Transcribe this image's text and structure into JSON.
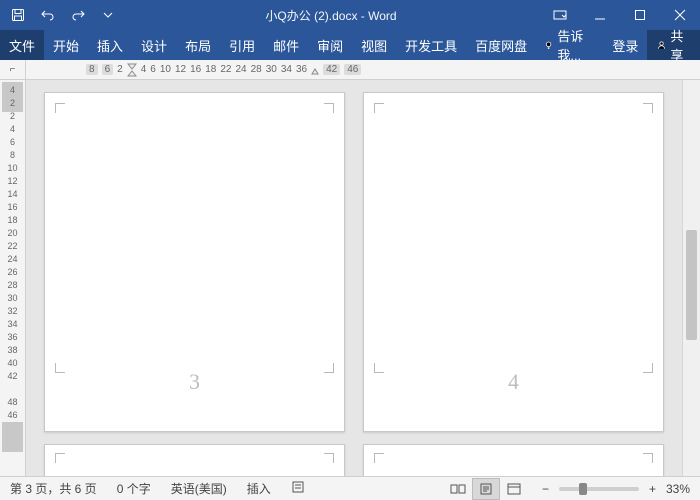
{
  "title": "小Q办公 (2).docx - Word",
  "qat": {
    "save": "save-icon",
    "undo": "undo-icon",
    "redo": "redo-icon"
  },
  "win": {
    "ribbon_opts": "ribbon-options",
    "min": "minimize",
    "max": "maximize",
    "close": "close"
  },
  "tabs": {
    "file": "文件",
    "home": "开始",
    "insert": "插入",
    "design": "设计",
    "layout": "布局",
    "references": "引用",
    "mailings": "邮件",
    "review": "审阅",
    "view": "视图",
    "dev": "开发工具",
    "baidu": "百度网盘",
    "tell": "告诉我...",
    "login": "登录",
    "share": "共享"
  },
  "ruler_corner": "⌐",
  "hruler_ticks": [
    "8",
    "6",
    "2",
    "4",
    "6",
    "10",
    "12",
    "16",
    "18",
    "22",
    "24",
    "28",
    "30",
    "34",
    "36",
    "42",
    "46"
  ],
  "vruler_ticks": [
    "4",
    "2",
    "2",
    "4",
    "6",
    "8",
    "10",
    "12",
    "14",
    "16",
    "18",
    "20",
    "22",
    "24",
    "26",
    "28",
    "30",
    "32",
    "34",
    "36",
    "38",
    "40",
    "42",
    "",
    "48",
    "46"
  ],
  "pages": [
    {
      "num": "3"
    },
    {
      "num": "4"
    },
    {
      "num": ""
    },
    {
      "num": ""
    }
  ],
  "status": {
    "page": "第 3 页，共 6 页",
    "words": "0 个字",
    "lang": "英语(美国)",
    "mode": "插入",
    "track": "",
    "zoom_pct": "33%"
  }
}
